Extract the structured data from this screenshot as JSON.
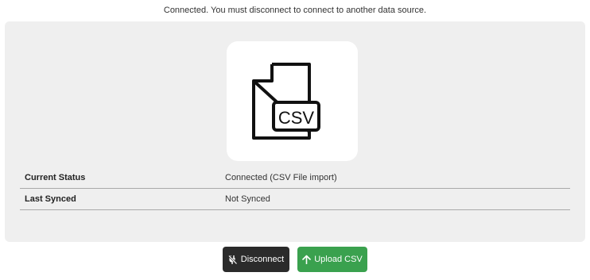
{
  "notice": "Connected. You must disconnect to connect to another data source.",
  "source_icon": {
    "name": "csv-file-icon",
    "badge_text": "CSV"
  },
  "status": {
    "rows": [
      {
        "label": "Current Status",
        "value": "Connected (CSV File import)"
      },
      {
        "label": "Last Synced",
        "value": "Not Synced"
      }
    ]
  },
  "actions": {
    "disconnect_label": "Disconnect",
    "disconnect_icon": "unplug-icon",
    "upload_label": "Upload CSV",
    "upload_icon": "arrow-up-icon"
  },
  "colors": {
    "panel_bg": "#efefef",
    "disconnect_bg": "#2b2b2b",
    "upload_bg": "#3aa14e"
  }
}
